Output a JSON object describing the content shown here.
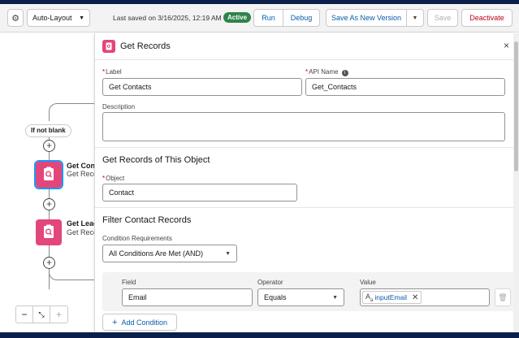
{
  "toolbar": {
    "layout_select": "Auto-Layout",
    "last_saved": "Last saved on 3/16/2025, 12:19 AM",
    "status_badge": "Active",
    "run": "Run",
    "debug": "Debug",
    "save_as_new": "Save As New Version",
    "save": "Save",
    "deactivate": "Deactivate"
  },
  "canvas": {
    "decision_label": "If not blank",
    "node1_title": "Get Cont",
    "node1_sub": "Get Recor",
    "node2_title": "Get Lead",
    "node2_sub": "Get Recor"
  },
  "panel": {
    "title": "Get Records",
    "label_label": "Label",
    "label_value": "Get Contacts",
    "api_label": "API Name",
    "api_value": "Get_Contacts",
    "description_label": "Description",
    "object_section": "Get Records of This Object",
    "object_label": "Object",
    "object_value": "Contact",
    "filter_section": "Filter Contact Records",
    "cond_req_label": "Condition Requirements",
    "cond_req_value": "All Conditions Are Met (AND)",
    "field_col": "Field",
    "operator_col": "Operator",
    "value_col": "Value",
    "field_value": "Email",
    "operator_value": "Equals",
    "value_pill": "inputEmail",
    "add_condition": "Add Condition"
  },
  "colors": {
    "accent": "#0b5cab",
    "active_badge": "#2e844a",
    "node_pink": "#e3467a"
  }
}
